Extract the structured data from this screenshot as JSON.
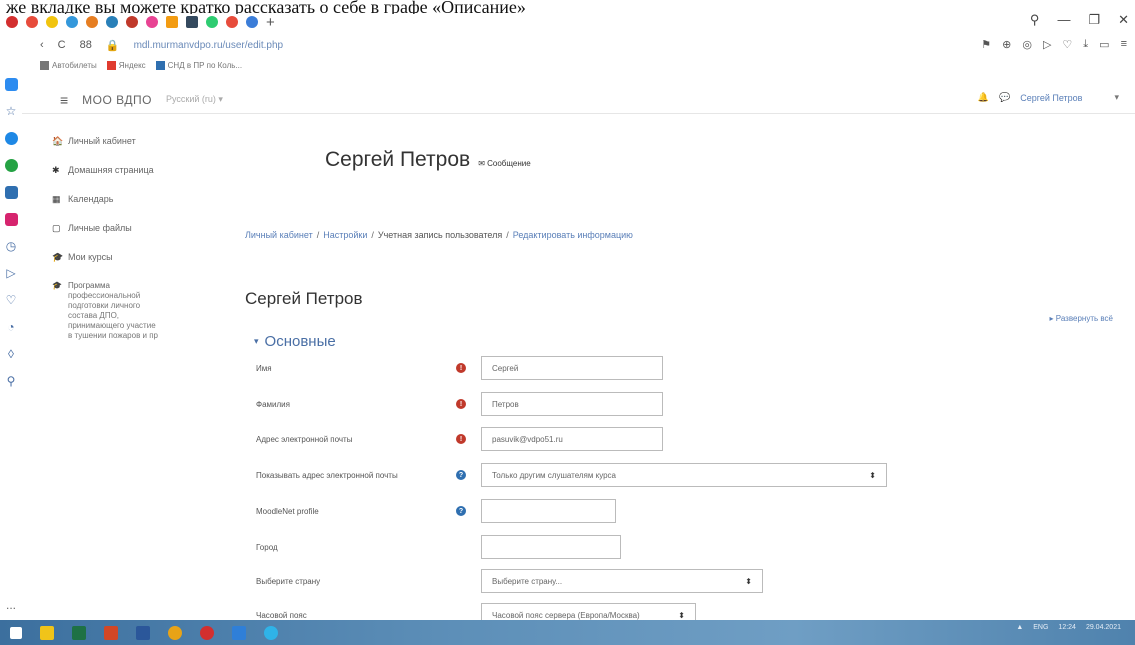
{
  "doc_text": "же вкладке вы можете кратко рассказать о себе в графе «Описание»",
  "browser": {
    "tab_plus": "+",
    "url_lock": "🔒",
    "url": "mdl.murmanvdpo.ru/user/edit.php",
    "reload_glyph": "C",
    "tab_count": "88",
    "window_controls": [
      "⚲",
      "—",
      "❐",
      "✕"
    ],
    "addr_icons": [
      "⚑",
      "⊕",
      "◎",
      "▷",
      "♡",
      "⤓",
      "▭",
      "≡"
    ],
    "bookmarks": [
      {
        "label": "Автобилеты",
        "color": "#777777"
      },
      {
        "label": "Яндекс",
        "color": "#e03b2f"
      },
      {
        "label": "СНД в ПР по Коль...",
        "color": "#2f6fb0"
      }
    ],
    "rail_more": "..."
  },
  "navbar": {
    "hamburger": "≡",
    "site_name": "МОО ВДПО",
    "lang": "Русский (ru) ▾",
    "user_name": "Сергей Петров",
    "user_caret": "▾"
  },
  "drawer": {
    "items": [
      {
        "icon": "🏠",
        "label": "Личный кабинет"
      },
      {
        "icon": "✱",
        "label": "Домашняя страница"
      },
      {
        "icon": "▦",
        "label": "Календарь"
      },
      {
        "icon": "▢",
        "label": "Личные файлы"
      },
      {
        "icon": "🎓",
        "label": "Мои курсы"
      }
    ],
    "program": {
      "icon": "🎓",
      "lines": [
        "Программа",
        "профессиональной",
        "подготовки личного",
        "состава ДПО,",
        "принимающего участие",
        "в тушении пожаров и пр"
      ]
    }
  },
  "content": {
    "top_heading": "Сергей Петров",
    "message_link": "✉ Сообщение",
    "breadcrumb": [
      "Личный кабинет",
      "Настройки",
      "Учетная запись пользователя",
      "Редактировать информацию"
    ],
    "page_heading": "Сергей Петров",
    "expand_all": "▸ Развернуть всё",
    "section_title": "Основные",
    "section_chevron": "▾"
  },
  "form": {
    "first_name": {
      "label": "Имя",
      "value": "Сергей"
    },
    "last_name": {
      "label": "Фамилия",
      "value": "Петров"
    },
    "email": {
      "label": "Адрес электронной почты",
      "value": "pasuvik@vdpo51.ru"
    },
    "email_display": {
      "label": "Показывать адрес электронной почты",
      "value": "Только другим слушателям курса"
    },
    "moodlenet": {
      "label": "MoodleNet profile",
      "value": ""
    },
    "city": {
      "label": "Город",
      "value": ""
    },
    "country": {
      "label": "Выберите страну",
      "value": "Выберите страну..."
    },
    "timezone": {
      "label": "Часовой пояс",
      "value": "Часовой пояс сервера (Европа/Москва)"
    }
  },
  "taskbar": {
    "tray": [
      "▲",
      "ENG",
      "12:24",
      "29.04.2021"
    ]
  }
}
